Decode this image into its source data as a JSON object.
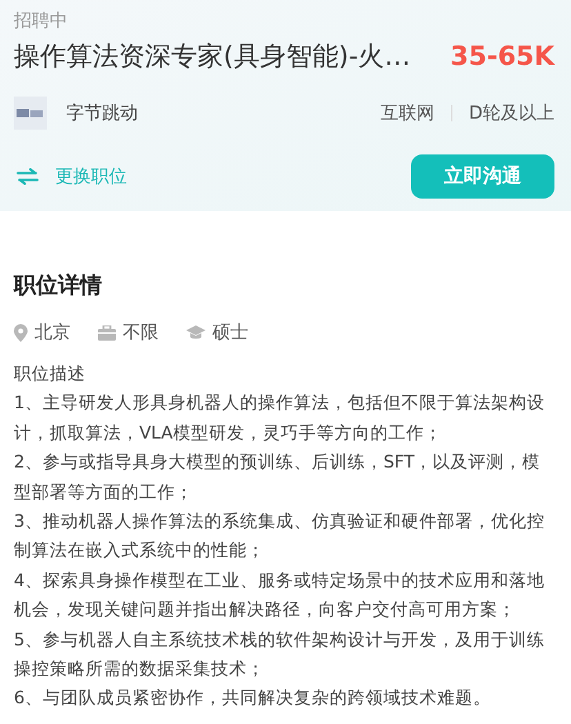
{
  "status": "招聘中",
  "job": {
    "title": "操作算法资深专家(具身智能)-火…",
    "salary": "35-65K"
  },
  "company": {
    "name": "字节跳动",
    "industry": "互联网",
    "stage": "D轮及以上"
  },
  "switch_label": "更换职位",
  "chat_button": "立即沟通",
  "details": {
    "heading": "职位详情",
    "tags": [
      {
        "kind": "location",
        "text": "北京"
      },
      {
        "kind": "experience",
        "text": "不限"
      },
      {
        "kind": "degree",
        "text": "硕士"
      }
    ],
    "description_title": "职位描述",
    "items": [
      "1、主导研发人形具身机器人的操作算法，包括但不限于算法架构设计，抓取算法，VLA模型研发，灵巧手等方向的工作；",
      "2、参与或指导具身大模型的预训练、后训练，SFT，以及评测，模型部署等方面的工作；",
      "3、推动机器人操作算法的系统集成、仿真验证和硬件部署，优化控制算法在嵌入式系统中的性能；",
      "4、探索具身操作模型在工业、服务或特定场景中的技术应用和落地机会，发现关键问题并指出解决路径，向客户交付高可用方案；",
      "5、参与机器人自主系统技术栈的软件架构设计与开发，及用于训练操控策略所需的数据采集技术；",
      "6、与团队成员紧密协作，共同解决复杂的跨领域技术难题。"
    ]
  }
}
